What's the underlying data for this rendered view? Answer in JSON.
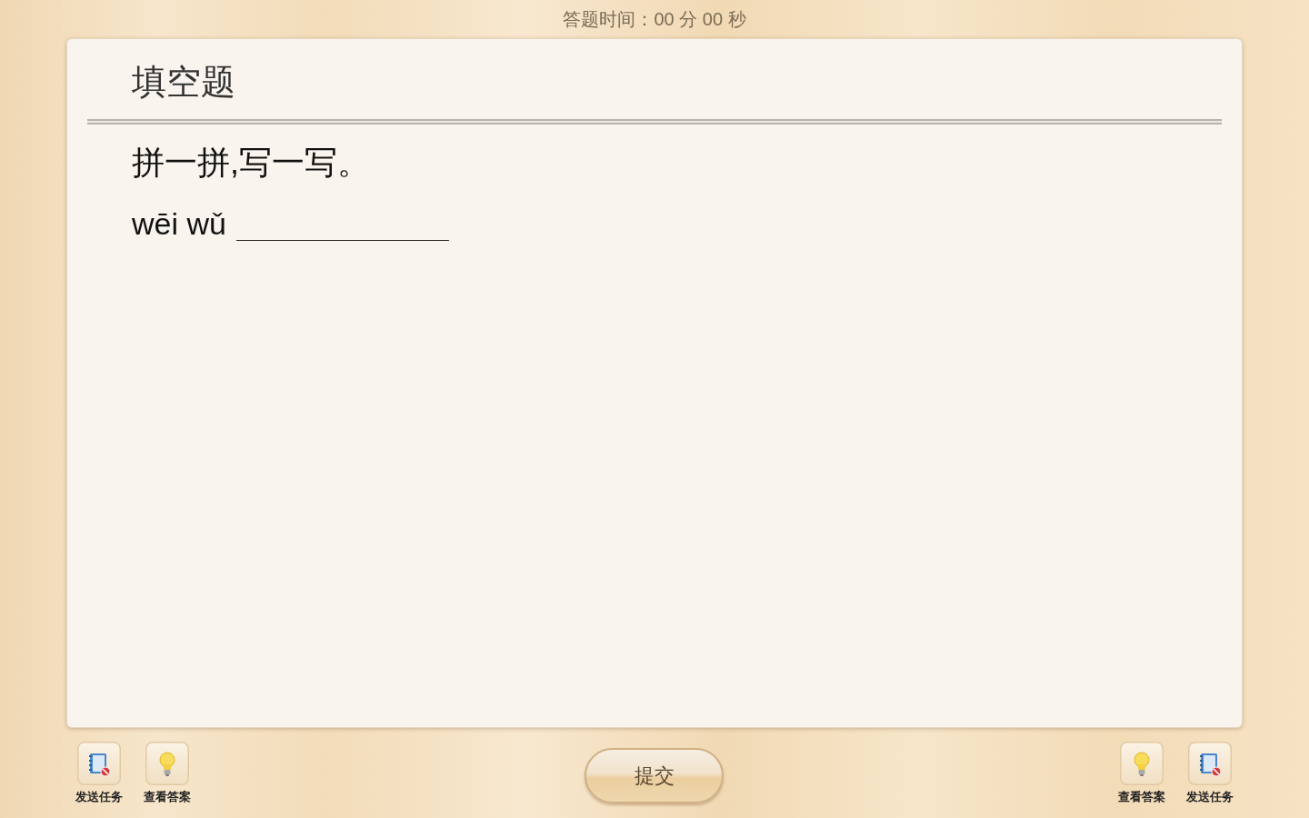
{
  "timer": "答题时间：00 分 00 秒",
  "question": {
    "type": "填空题",
    "prompt": "拼一拼,写一写。",
    "items": [
      {
        "pinyin": "wēi wǔ"
      }
    ]
  },
  "toolbar_left": [
    {
      "kind": "send",
      "label": "发送任务"
    },
    {
      "kind": "answer",
      "label": "查看答案"
    }
  ],
  "submit_button": "提交",
  "toolbar_right": [
    {
      "kind": "answer",
      "label": "查看答案"
    },
    {
      "kind": "send",
      "label": "发送任务"
    }
  ]
}
